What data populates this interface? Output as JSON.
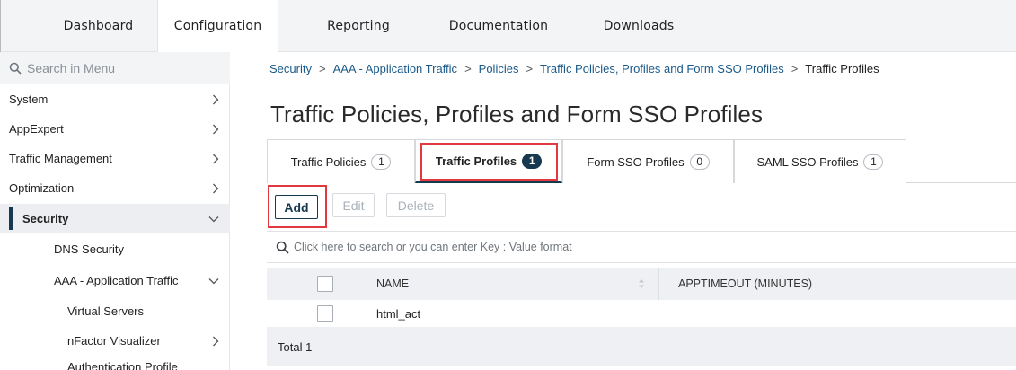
{
  "topnav": {
    "tabs": [
      {
        "label": "Dashboard"
      },
      {
        "label": "Configuration"
      },
      {
        "label": "Reporting"
      },
      {
        "label": "Documentation"
      },
      {
        "label": "Downloads"
      }
    ],
    "active_tab": "Configuration"
  },
  "sidebar": {
    "search_placeholder": "Search in Menu",
    "items": [
      {
        "label": "System",
        "icon": "chevron-right-icon"
      },
      {
        "label": "AppExpert",
        "icon": "chevron-right-icon"
      },
      {
        "label": "Traffic Management",
        "icon": "chevron-right-icon"
      },
      {
        "label": "Optimization",
        "icon": "chevron-right-icon"
      },
      {
        "label": "Security",
        "icon": "chevron-down-icon",
        "selected": true
      },
      {
        "label": "DNS Security"
      },
      {
        "label": "AAA - Application Traffic",
        "icon": "chevron-down-icon"
      },
      {
        "label": "Virtual Servers"
      },
      {
        "label": "nFactor Visualizer",
        "icon": "chevron-right-icon"
      },
      {
        "label": "Authentication Profile"
      }
    ]
  },
  "breadcrumb": [
    {
      "label": "Security"
    },
    {
      "label": "AAA - Application Traffic"
    },
    {
      "label": "Policies"
    },
    {
      "label": "Traffic Policies, Profiles and Form SSO Profiles"
    },
    {
      "label": "Traffic Profiles"
    }
  ],
  "page_title": "Traffic Policies, Profiles and Form SSO Profiles",
  "subtabs": [
    {
      "label": "Traffic Policies",
      "count": "1"
    },
    {
      "label": "Traffic Profiles",
      "count": "1",
      "active": true
    },
    {
      "label": "Form SSO Profiles",
      "count": "0"
    },
    {
      "label": "SAML SSO Profiles",
      "count": "1"
    }
  ],
  "toolbar": {
    "add_label": "Add",
    "edit_label": "Edit",
    "delete_label": "Delete"
  },
  "table_search": {
    "placeholder": "Click here to search or you can enter Key : Value format"
  },
  "table": {
    "columns": [
      "NAME",
      "APPTIMEOUT (MINUTES)"
    ],
    "rows": [
      {
        "name": "html_act",
        "apptimeout": ""
      }
    ],
    "footer": "Total 1"
  },
  "colors": {
    "accent": "#16394f",
    "link": "#1a5a8a",
    "highlight_box": "#e0393f",
    "nav_bg": "#f3f4f6"
  }
}
